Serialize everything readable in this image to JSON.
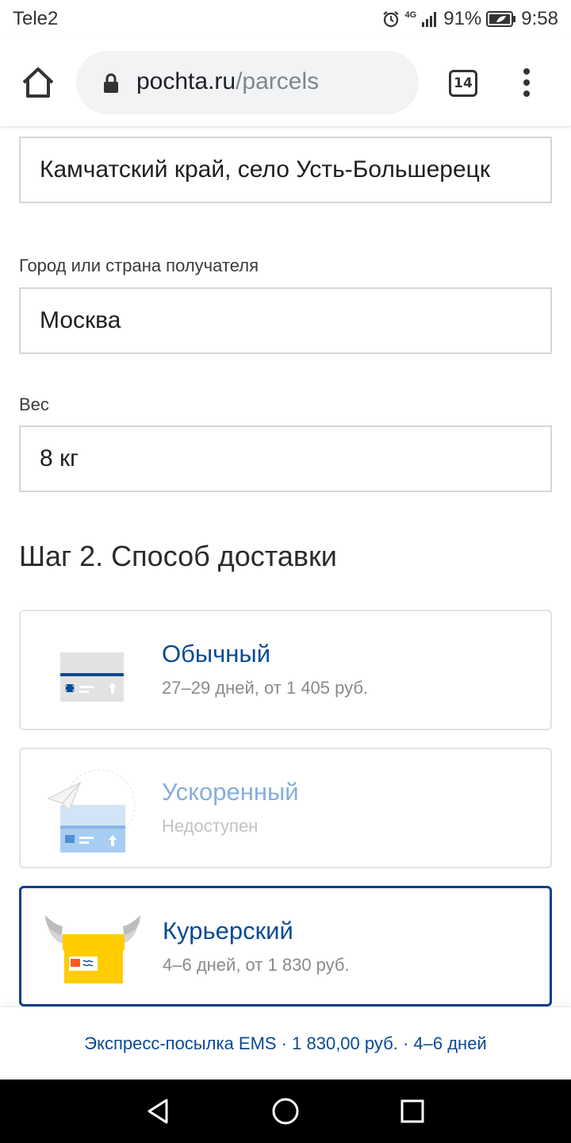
{
  "status_bar": {
    "carrier": "Tele2",
    "battery": "91%",
    "time": "9:58",
    "network": "4G"
  },
  "browser": {
    "url_host": "pochta.ru",
    "url_path": "/parcels",
    "tab_count": "14"
  },
  "form": {
    "sender_value": "Камчатский край, село Усть-Большерецк",
    "recipient_label": "Город или страна получателя",
    "recipient_value": "Москва",
    "weight_label": "Вес",
    "weight_value": "8 кг"
  },
  "step2": {
    "title": "Шаг 2. Способ доставки",
    "options": [
      {
        "title": "Обычный",
        "subtitle": "27–29 дней, от 1 405 руб.",
        "state": "available",
        "icon": "parcel-standard-icon"
      },
      {
        "title": "Ускоренный",
        "subtitle": "Недоступен",
        "state": "disabled",
        "icon": "parcel-express-icon"
      },
      {
        "title": "Курьерский",
        "subtitle": "4–6 дней, от 1 830 руб.",
        "state": "selected",
        "icon": "parcel-courier-icon"
      }
    ]
  },
  "summary": {
    "text": "Экспресс-посылка EMS · 1 830,00 руб. · 4–6 дней"
  },
  "colors": {
    "accent": "#0a4a94",
    "selected_border": "#0a3f8c",
    "courier_yellow": "#ffcc00"
  }
}
